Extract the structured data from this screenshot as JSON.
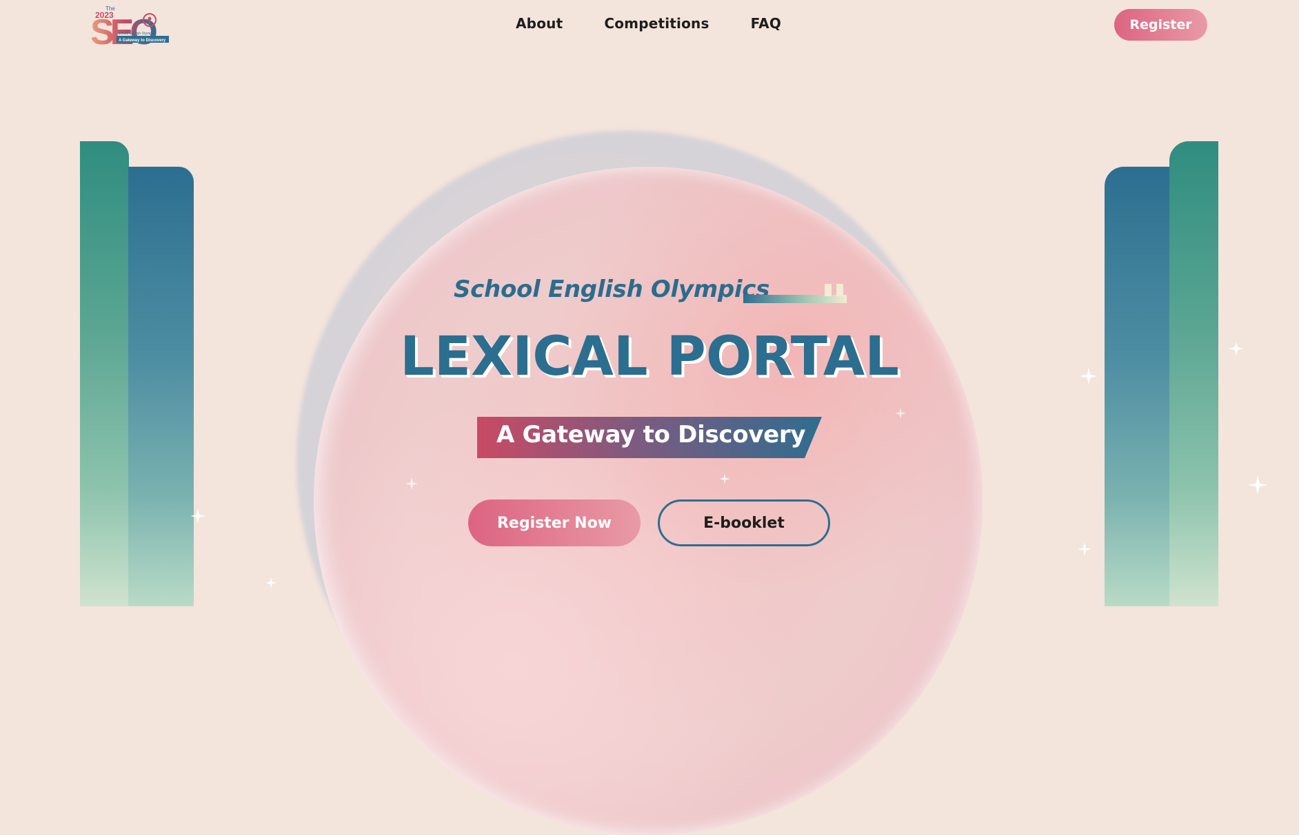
{
  "logo": {
    "year_small": "The",
    "year": "2023",
    "letters": "SEO",
    "line1": "School English Olympics",
    "line2": "A Gateway to Discovery",
    "icon": "keyhole-icon"
  },
  "nav": {
    "items": [
      {
        "label": "About"
      },
      {
        "label": "Competitions"
      },
      {
        "label": "FAQ"
      }
    ],
    "register_label": "Register"
  },
  "hero": {
    "eyebrow": "School English Olympics",
    "title": "LEXICAL PORTAL",
    "tagline": "A Gateway to Discovery",
    "primary_cta": "Register Now",
    "secondary_cta": "E-booklet"
  },
  "colors": {
    "background": "#f3e4dc",
    "brand_blue": "#2b6e90",
    "brand_pink": "#dc6482",
    "teal": "#2f8d80"
  }
}
